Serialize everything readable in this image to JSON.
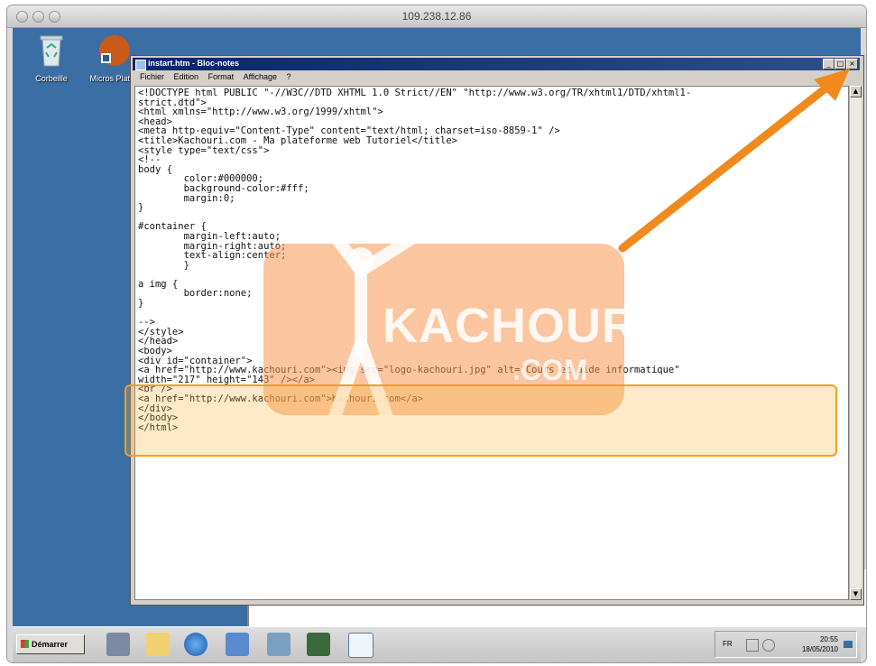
{
  "mac_window": {
    "title": "109.238.12.86"
  },
  "desktop": {
    "icons": [
      {
        "label": "Corbeille",
        "icon": "recycle-bin-icon"
      },
      {
        "label": "Micros Platfor",
        "icon": "web-platform-icon"
      }
    ]
  },
  "notepad": {
    "title": "instart.htm - Bloc-notes",
    "menu": [
      "Fichier",
      "Edition",
      "Format",
      "Affichage",
      "?"
    ],
    "content": "<!DOCTYPE html PUBLIC \"-//W3C//DTD XHTML 1.0 Strict//EN\" \"http://www.w3.org/TR/xhtml1/DTD/xhtml1-\nstrict.dtd\">\n<html xmlns=\"http://www.w3.org/1999/xhtml\">\n<head>\n<meta http-equiv=\"Content-Type\" content=\"text/html; charset=iso-8859-1\" />\n<title>Kachouri.com - Ma plateforme web Tutoriel</title>\n<style type=\"text/css\">\n<!--\nbody {\n        color:#000000;\n        background-color:#fff;\n        margin:0;\n}\n\n#container {\n        margin-left:auto;\n        margin-right:auto;\n        text-align:center;\n        }\n\na img {\n        border:none;\n}\n\n-->\n</style>\n</head>\n<body>\n<div id=\"container\">\n<a href=\"http://www.kachouri.com\"><img src=\"logo-kachouri.jpg\" alt=\"Cours et aide informatique\"\nwidth=\"217\" height=\"143\" /></a>\n<br />\n<a href=\"http://www.kachouri.com\">Kachouri.com</a>\n</div>\n</body>\n</html>"
  },
  "watermark": {
    "brand": "KACHOURI",
    "suffix": ".COM"
  },
  "taskbar": {
    "start_label": "Démarrer",
    "apps": [
      "server-manager-icon",
      "folder-icon",
      "internet-explorer-icon",
      "remote-desktop-icon",
      "network-icon",
      "terminal-icon",
      "notepad-icon"
    ],
    "language": "FR",
    "time": "20:55",
    "date": "18/05/2010"
  },
  "colors": {
    "desktop": "#3a6ea5",
    "highlight": "#f0a020",
    "arrow": "#f08a1c",
    "titlebar": "#0a246a"
  }
}
